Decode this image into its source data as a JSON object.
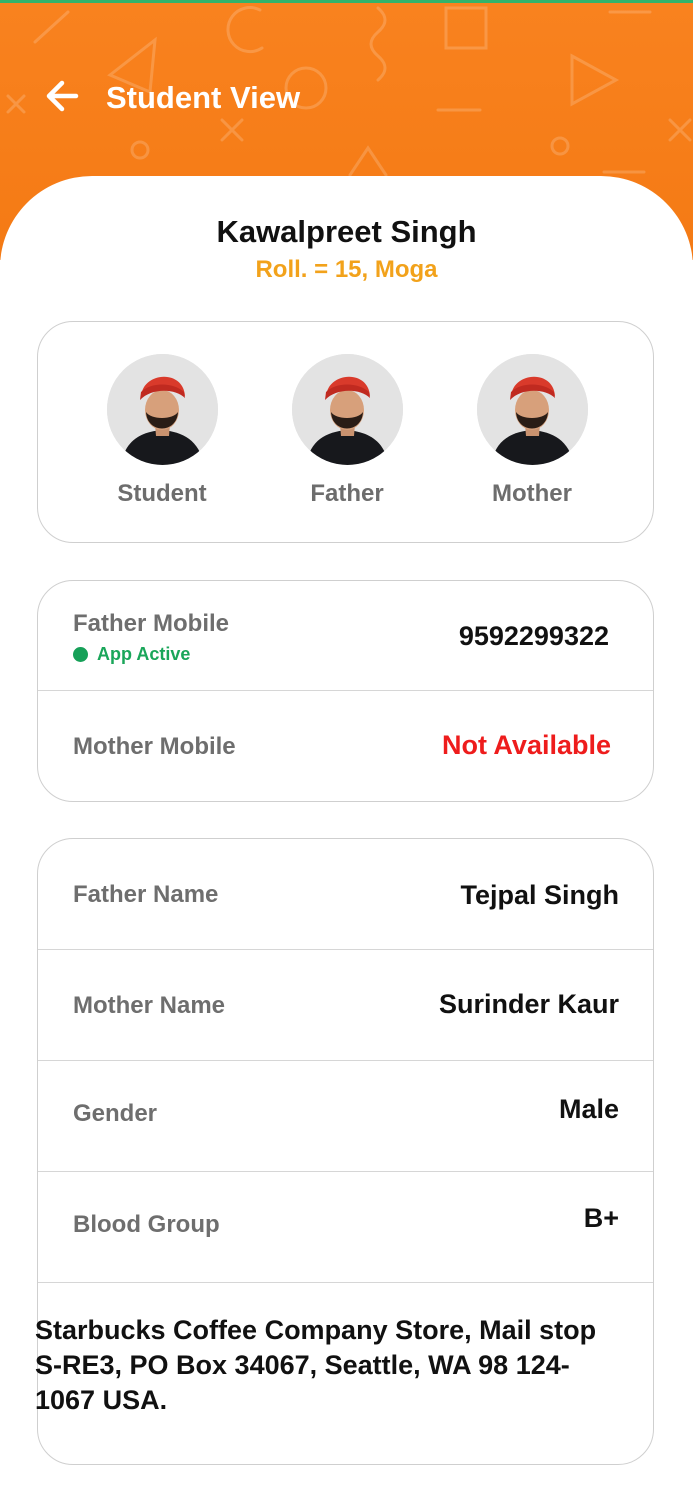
{
  "header": {
    "title": "Student View",
    "back_icon": "arrow-left-icon"
  },
  "student": {
    "name": "Kawalpreet Singh",
    "roll_line": "Roll. = 15, Moga"
  },
  "photos": [
    {
      "label": "Student"
    },
    {
      "label": "Father"
    },
    {
      "label": "Mother"
    }
  ],
  "contacts": {
    "father_mobile_label": "Father Mobile",
    "father_app_status": "App Active",
    "father_mobile_value": "9592299322",
    "mother_mobile_label": "Mother Mobile",
    "mother_mobile_value": "Not Available"
  },
  "details": [
    {
      "label": "Father Name",
      "value": "Tejpal Singh"
    },
    {
      "label": "Mother Name",
      "value": "Surinder Kaur"
    },
    {
      "label": "Gender",
      "value": "Male"
    },
    {
      "label": "Blood Group",
      "value": "B+"
    }
  ],
  "address": "Starbucks Coffee Company Store, Mail stop S-RE3, PO Box 34067, Seattle, WA 98 124-1067 USA.",
  "colors": {
    "header": "#f9821f",
    "accent_orange": "#f2a21b",
    "status_green": "#16a058",
    "unavailable_red": "#ee1c1c"
  }
}
